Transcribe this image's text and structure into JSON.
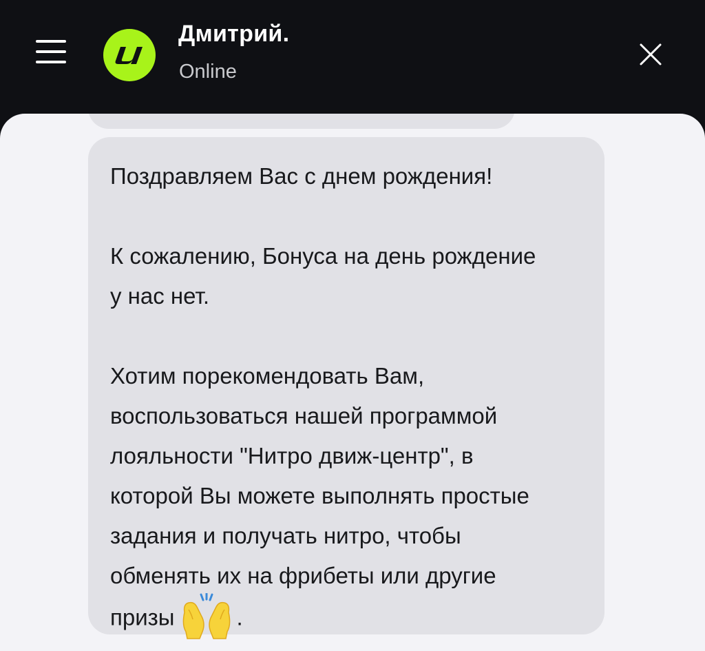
{
  "header": {
    "title": "Дмитрий.",
    "status": "Online",
    "menu_icon": "hamburger-menu-icon",
    "close_icon": "close-icon",
    "avatar_letter": "и",
    "colors": {
      "background": "#0f1014",
      "avatar": "#a8f31a"
    }
  },
  "chat": {
    "background": "#f3f3f7",
    "bubble_color": "#e1e1e6",
    "message": {
      "text": "Поздравляем Вас с днем рождения!\n\nК сожалению, Бонуса на день рождение\nу нас нет.\n\nХотим порекомендовать Вам,\nвоспользоваться нашей программой\nлояльности \"Нитро движ-центр\", в\nкоторой Вы можете выполнять простые\nзадания и получать нитро, чтобы\nобменять их на фрибеты или другие\nпризы",
      "emoji": "raising-hands-emoji",
      "end": "."
    }
  }
}
